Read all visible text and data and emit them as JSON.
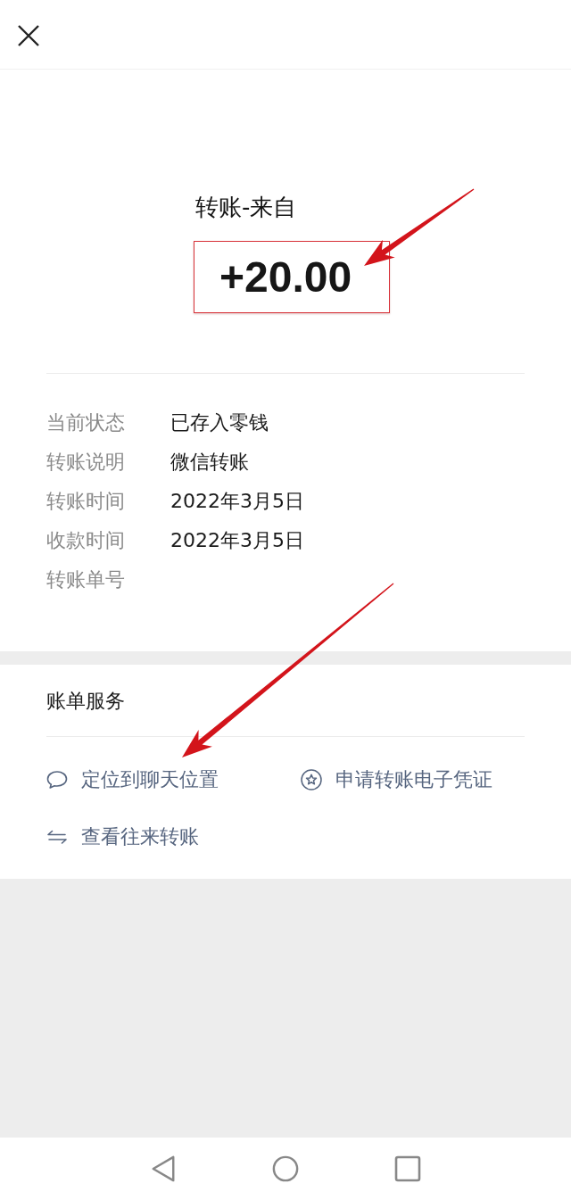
{
  "transfer": {
    "title": "转账-来自",
    "amount": "+20.00",
    "highlighted": true
  },
  "details": [
    {
      "label": "当前状态",
      "value": "已存入零钱"
    },
    {
      "label": "转账说明",
      "value": "微信转账"
    },
    {
      "label": "转账时间",
      "value": "2022年3月5日"
    },
    {
      "label": "收款时间",
      "value": "2022年3月5日"
    },
    {
      "label": "转账单号"
    }
  ],
  "services": {
    "title": "账单服务",
    "items": [
      {
        "kind": "chat",
        "label": "定位到聊天位置"
      },
      {
        "kind": "certificate",
        "label": "申请转账电子凭证"
      },
      {
        "kind": "exchange",
        "label": "查看往来转账"
      }
    ]
  }
}
